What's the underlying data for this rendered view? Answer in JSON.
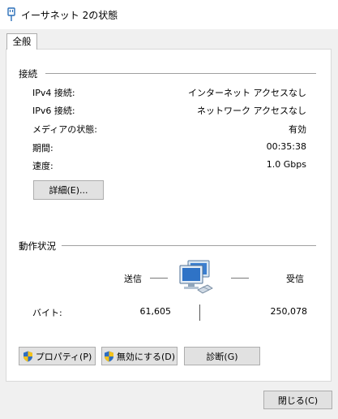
{
  "window": {
    "title": "イーサネット 2の状態",
    "title_icon": "ethernet-plug-icon"
  },
  "tabs": [
    {
      "label": "全般",
      "selected": true
    }
  ],
  "connection": {
    "group_label": "接続",
    "rows": [
      {
        "label": "IPv4 接続:",
        "value": "インターネット アクセスなし"
      },
      {
        "label": "IPv6 接続:",
        "value": "ネットワーク アクセスなし"
      },
      {
        "label": "メディアの状態:",
        "value": "有効"
      },
      {
        "label": "期間:",
        "value": "00:35:38"
      },
      {
        "label": "速度:",
        "value": "1.0 Gbps"
      }
    ],
    "details_button": "詳細(E)..."
  },
  "activity": {
    "group_label": "動作状況",
    "sent_label": "送信",
    "received_label": "受信",
    "bytes_label": "バイト:",
    "sent_bytes": "61,605",
    "received_bytes": "250,078",
    "icon": "network-computers-icon"
  },
  "buttons": {
    "properties": "プロパティ(P)",
    "disable": "無効にする(D)",
    "diagnose": "診断(G)",
    "close": "閉じる(C)"
  }
}
